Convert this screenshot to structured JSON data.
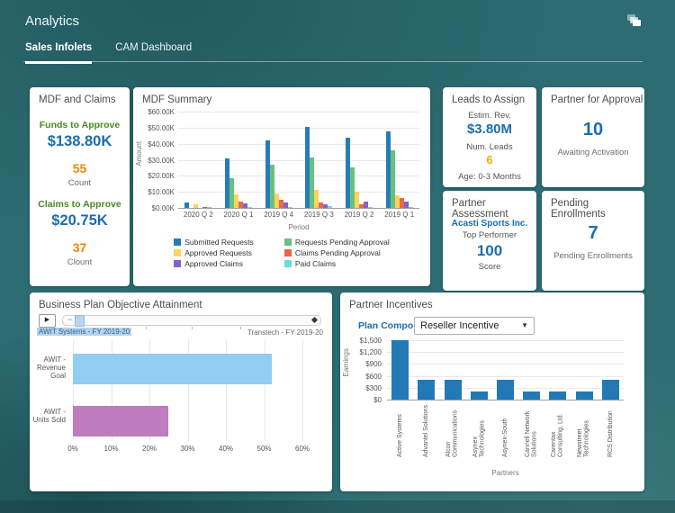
{
  "header": {
    "title": "Analytics",
    "tabs": [
      {
        "label": "Sales Infolets",
        "active": true
      },
      {
        "label": "CAM Dashboard",
        "active": false
      }
    ]
  },
  "icons": {
    "top_right": "stacked-pages-icon"
  },
  "colors": {
    "background": "#2c6c72",
    "accent_blue": "#1a6daf",
    "accent_green": "#478a21",
    "accent_orange": "#ef8507",
    "accent_yellow": "#eead0c"
  },
  "cards": {
    "mdf_claims": {
      "title": "MDF and Claims",
      "sections": [
        {
          "label": "Funds to Approve",
          "value": "$138.80K",
          "count": "55",
          "count_label": "Count"
        },
        {
          "label": "Claims to Approve",
          "value": "$20.75K",
          "count": "37",
          "count_label": "Clount"
        }
      ]
    },
    "leads_to_assign": {
      "title": "Leads to Assign",
      "rev_label": "Estim. Rev.",
      "rev_value": "$3.80M",
      "leads_label": "Num. Leads",
      "leads_value": "6",
      "age_label": "Age: 0-3 Months"
    },
    "partner_for_approval": {
      "title": "Partner for Approval",
      "value": "10",
      "label": "Awaiting Activation"
    },
    "partner_assessment": {
      "title": "Partner Assessment",
      "partner": "Acasti Sports Inc.",
      "subtitle": "Top Performer",
      "value": "100",
      "label": "Score"
    },
    "pending_enrollments": {
      "title": "Pending Enrollments",
      "value": "7",
      "label": "Pending Enrollments"
    },
    "partner_incentives": {
      "plan_component_label": "Plan Component",
      "plan_component_value": "Reseller Incentive"
    }
  },
  "chart_data": [
    {
      "id": "mdf_summary",
      "type": "bar",
      "title": "MDF Summary",
      "xlabel": "Period",
      "ylabel": "Amount",
      "ylim": [
        0,
        60
      ],
      "unit": "K USD",
      "ytick_labels": [
        "$60.00K",
        "$50.00K",
        "$40.00K",
        "$30.00K",
        "$20.00K",
        "$10.00K",
        "$0.00K"
      ],
      "categories": [
        "2020 Q 2",
        "2020 Q 1",
        "2019 Q 4",
        "2019 Q 3",
        "2019 Q 2",
        "2019 Q 1"
      ],
      "legend_position": "bottom",
      "grid": true,
      "series": [
        {
          "name": "Submitted Requests",
          "color": "#267db3",
          "values": [
            3.5,
            31,
            42,
            50.5,
            43.5,
            47.5
          ]
        },
        {
          "name": "Requests Pending Approval",
          "color": "#68c182",
          "values": [
            0,
            18.5,
            27,
            31.5,
            25.5,
            36
          ]
        },
        {
          "name": "Approved Requests",
          "color": "#fad55c",
          "values": [
            2.5,
            8.5,
            9,
            11,
            10,
            8
          ]
        },
        {
          "name": "Claims Pending Approval",
          "color": "#ed6647",
          "values": [
            0,
            4,
            4.8,
            3.5,
            2.5,
            6
          ]
        },
        {
          "name": "Approved Claims",
          "color": "#8561c8",
          "values": [
            0.7,
            3,
            3.3,
            2.5,
            4,
            4
          ]
        },
        {
          "name": "Paid Claims",
          "color": "#6ddbdb",
          "values": [
            0.5,
            0.3,
            0.3,
            1,
            0.3,
            0.5
          ]
        }
      ]
    },
    {
      "id": "business_plan",
      "type": "bar",
      "orientation": "horizontal",
      "title": "Business Plan Objective Attainment",
      "xlim": [
        0,
        60
      ],
      "xtick_labels": [
        "0%",
        "10%",
        "20%",
        "30%",
        "40%",
        "50%",
        "60%"
      ],
      "categories": [
        "AWIT - Revenue Goal",
        "AWIT - Units Sold"
      ],
      "values": [
        52,
        25
      ],
      "colors": [
        "#92cdf4",
        "#bf7cbe"
      ],
      "grid": true,
      "timeline": {
        "start_label": "AWIT Systems - FY 2019-20",
        "end_label": "Transtech - FY 2019-20"
      }
    },
    {
      "id": "partner_incentives",
      "type": "bar",
      "title": "Partner Incentives",
      "xlabel": "Partners",
      "ylabel": "Earnings",
      "ylim": [
        0,
        1500
      ],
      "ytick_labels": [
        "$1,500",
        "$1,200",
        "$900",
        "$600",
        "$300",
        "$0"
      ],
      "bar_color": "#2279b5",
      "grid": true,
      "categories": [
        "Active Systems",
        "Advantel Solutions",
        "Alcon Communications",
        "Asynex Technologies",
        "Asynex-South",
        "Cannell Network Solutions",
        "Carentax Consulting, Ltd.",
        "Newstreet Technologies",
        "RCS Distribution"
      ],
      "values": [
        1500,
        500,
        500,
        200,
        500,
        200,
        200,
        200,
        500
      ]
    }
  ]
}
